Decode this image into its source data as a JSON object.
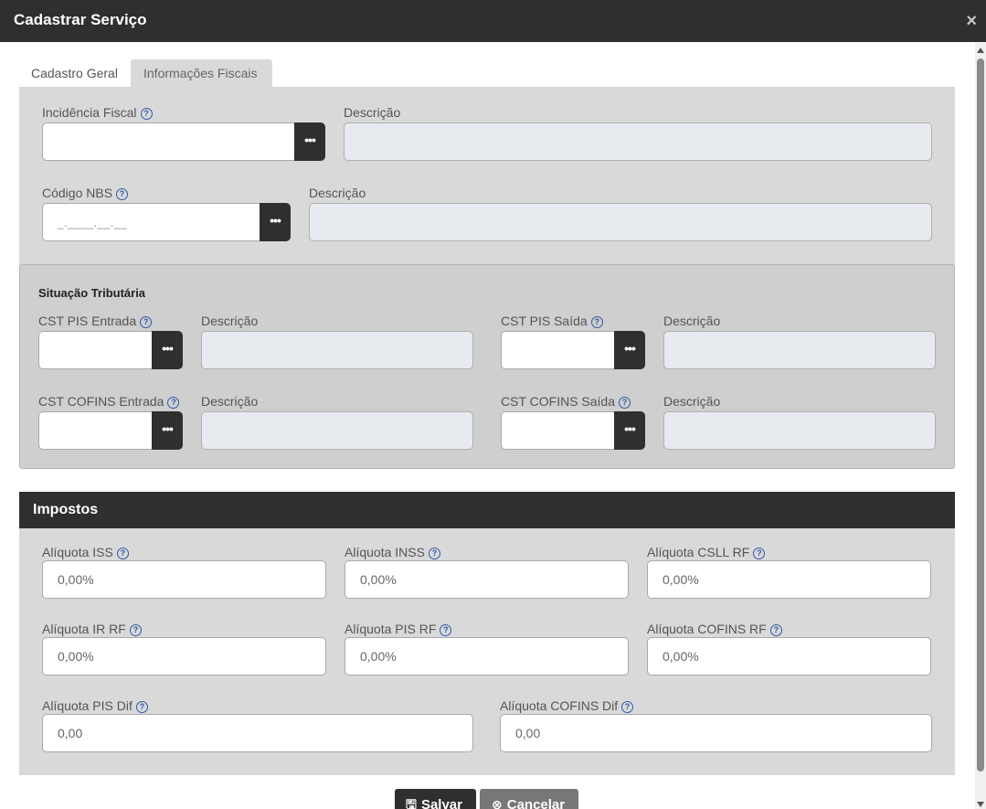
{
  "modal": {
    "title": "Cadastrar Serviço",
    "close": "×"
  },
  "tabs": [
    {
      "label": "Cadastro Geral",
      "active": false
    },
    {
      "label": "Informações Fiscais",
      "active": true
    }
  ],
  "fiscal": {
    "incidencia": {
      "label": "Incidência Fiscal",
      "value": ""
    },
    "incidencia_desc": {
      "label": "Descrição",
      "value": ""
    },
    "nbs": {
      "label": "Código NBS",
      "mask": "_.____.__.__"
    },
    "nbs_desc": {
      "label": "Descrição",
      "value": ""
    },
    "lookup": "•••"
  },
  "situacao": {
    "title": "Situação Tributária",
    "pis_entrada": "CST PIS Entrada",
    "pis_saida": "CST PIS Saída",
    "cofins_entrada": "CST COFINS Entrada",
    "cofins_saida": "CST COFINS Saída",
    "descricao": "Descrição"
  },
  "impostos": {
    "title": "Impostos",
    "iss": {
      "label": "Alíquota ISS",
      "value": "0,00%"
    },
    "inss": {
      "label": "Alíquota INSS",
      "value": "0,00%"
    },
    "csll": {
      "label": "Alíquota CSLL RF",
      "value": "0,00%"
    },
    "ir": {
      "label": "Alíquota IR RF",
      "value": "0,00%"
    },
    "pis": {
      "label": "Alíquota PIS RF",
      "value": "0,00%"
    },
    "cofins": {
      "label": "Alíquota COFINS RF",
      "value": "0,00%"
    },
    "pis_dif": {
      "label": "Alíquota PIS Dif",
      "value": "0,00"
    },
    "cofins_dif": {
      "label": "Alíquota COFINS Dif",
      "value": "0,00"
    }
  },
  "help_icon": "?",
  "footer": {
    "save": "Salvar",
    "cancel": "Cancelar",
    "save_icon": "🖫",
    "cancel_icon": "⊗"
  }
}
